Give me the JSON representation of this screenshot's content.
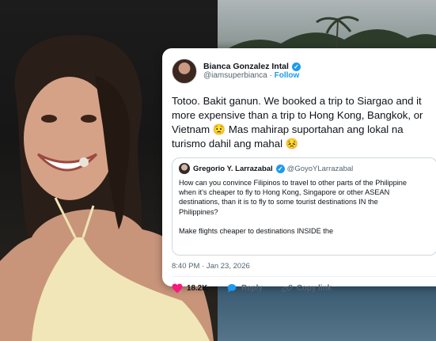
{
  "tweet": {
    "display_name": "Bianca Gonzalez Intal",
    "handle": "@iamsuperbianca",
    "separator": "·",
    "follow_label": "Follow",
    "text_lines": [
      "Totoo. Bakit ganun. We booked a trip to Siargao and it",
      "more expensive than a trip to Hong Kong, Bangkok, or",
      "Vietnam 😟 Mas mahirap suportahan ang lokal na",
      "turismo dahil ang mahal 😣"
    ],
    "quote": {
      "display_name": "Gregorio Y. Larrazabal",
      "handle": "@GoyoYLarrazabal",
      "lines": [
        "How can you convince Filipinos to travel to other parts of the Philippine",
        "when it's cheaper to fly to Hong Kong, Singapore or other ASEAN",
        "destinations, than it is to fly to some tourist destinations IN the",
        "Philippines?",
        "",
        "Make flights cheaper to destinations INSIDE the"
      ]
    },
    "timestamp": "8:40 PM · Jan 23, 2026",
    "like_count": "18.2K",
    "reply_label": "Reply",
    "copy_link_label": "Copy link",
    "verified_color": "#1d9bf0",
    "like_color": "#f91880"
  }
}
